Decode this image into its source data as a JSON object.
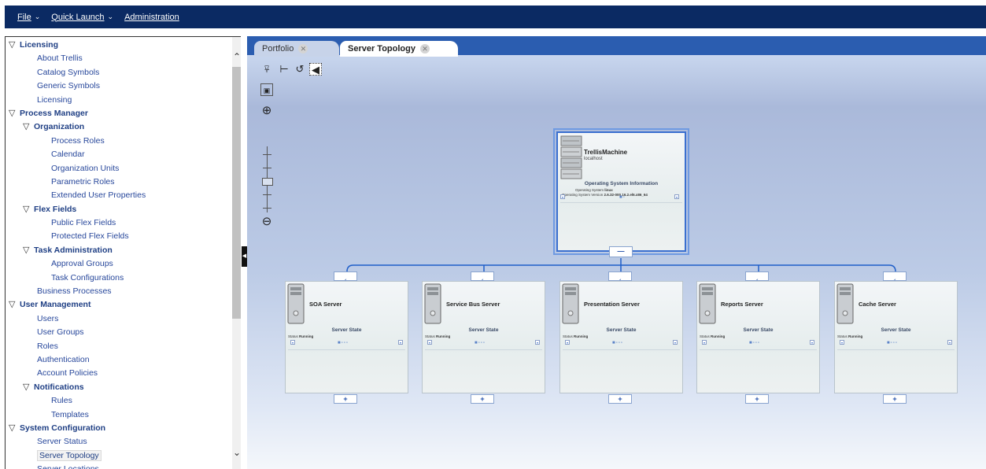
{
  "menu": {
    "file": "File",
    "quick_launch": "Quick Launch",
    "administration": "Administration"
  },
  "nav": [
    {
      "label": "Licensing",
      "type": "lvl0"
    },
    {
      "label": "About Trellis",
      "type": "leaf1"
    },
    {
      "label": "Catalog Symbols",
      "type": "leaf1"
    },
    {
      "label": "Generic Symbols",
      "type": "leaf1"
    },
    {
      "label": "Licensing",
      "type": "leaf1"
    },
    {
      "label": "Process Manager",
      "type": "lvl0"
    },
    {
      "label": "Organization",
      "type": "lvl1"
    },
    {
      "label": "Process Roles",
      "type": "leaf2"
    },
    {
      "label": "Calendar",
      "type": "leaf2"
    },
    {
      "label": "Organization Units",
      "type": "leaf2"
    },
    {
      "label": "Parametric Roles",
      "type": "leaf2"
    },
    {
      "label": "Extended User Properties",
      "type": "leaf2"
    },
    {
      "label": "Flex Fields",
      "type": "lvl1"
    },
    {
      "label": "Public Flex Fields",
      "type": "leaf2"
    },
    {
      "label": "Protected Flex Fields",
      "type": "leaf2"
    },
    {
      "label": "Task Administration",
      "type": "lvl1"
    },
    {
      "label": "Approval Groups",
      "type": "leaf2"
    },
    {
      "label": "Task Configurations",
      "type": "leaf2"
    },
    {
      "label": "Business Processes",
      "type": "leaf1"
    },
    {
      "label": "User Management",
      "type": "lvl0"
    },
    {
      "label": "Users",
      "type": "leaf1"
    },
    {
      "label": "User Groups",
      "type": "leaf1"
    },
    {
      "label": "Roles",
      "type": "leaf1"
    },
    {
      "label": "Authentication",
      "type": "leaf1"
    },
    {
      "label": "Account Policies",
      "type": "leaf1"
    },
    {
      "label": "Notifications",
      "type": "lvl1"
    },
    {
      "label": "Rules",
      "type": "leaf2"
    },
    {
      "label": "Templates",
      "type": "leaf2"
    },
    {
      "label": "System Configuration",
      "type": "lvl0"
    },
    {
      "label": "Server Status",
      "type": "leaf1"
    },
    {
      "label": "Server Topology",
      "type": "leaf1",
      "selected": true
    },
    {
      "label": "Server Locations",
      "type": "leaf1"
    }
  ],
  "tabs": {
    "portfolio": "Portfolio",
    "topology": "Server Topology"
  },
  "machine": {
    "title": "TrellisMachine",
    "host": "localhost",
    "section": "Operating System Information",
    "os_label": "Operating System",
    "os_value": "linux",
    "version_label": "Operating System Version",
    "version_value": "2.6.32-000.16.2.el6.x86_64"
  },
  "servers": [
    {
      "name": "SOA Server",
      "section": "Server State",
      "status_label": "Status",
      "status_value": "Running"
    },
    {
      "name": "Service Bus Server",
      "section": "Server State",
      "status_label": "Status",
      "status_value": "Running"
    },
    {
      "name": "Presentation Server",
      "section": "Server State",
      "status_label": "Status",
      "status_value": "Running"
    },
    {
      "name": "Reports Server",
      "section": "Server State",
      "status_label": "Status",
      "status_value": "Running"
    },
    {
      "name": "Cache Server",
      "section": "Server State",
      "status_label": "Status",
      "status_value": "Running"
    }
  ],
  "colors": {
    "menubar": "#0b2a63",
    "nav_text": "#1f3f84",
    "tabbar": "#2b5db0",
    "selection": "#3a6fcf"
  }
}
